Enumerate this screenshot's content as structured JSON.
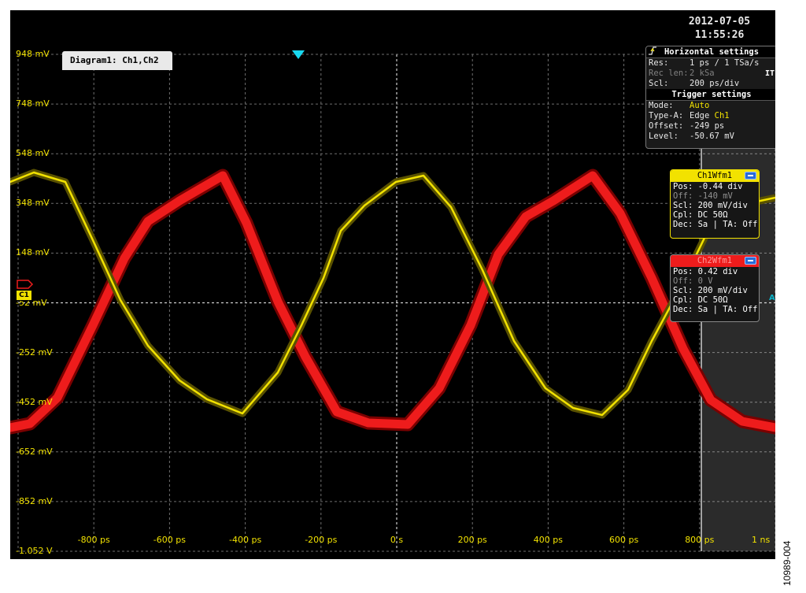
{
  "datetime": {
    "date": "2012-07-05",
    "time": "11:55:26"
  },
  "diagram": {
    "title": "Diagram1: Ch1,Ch2"
  },
  "y_axis_labels": [
    "948 mV",
    "748 mV",
    "548 mV",
    "348 mV",
    "148 mV",
    "-52 mV",
    "-252 mV",
    "-452 mV",
    "-652 mV",
    "-852 mV",
    "-1.052 V"
  ],
  "x_axis_labels": [
    "-800 ps",
    "-600 ps",
    "-400 ps",
    "-200 ps",
    "0 s",
    "200 ps",
    "400 ps",
    "600 ps",
    "800 ps",
    "1 ns"
  ],
  "horizontal_settings": {
    "header": "Horizontal settings",
    "res_key": "Res:",
    "res_val": "1 ps / 1 TSa/s",
    "reclen_key": "Rec len:",
    "reclen_val": "2 kSa",
    "scl_key": "Scl:",
    "scl_val": "200 ps/div",
    "it_label": "IT"
  },
  "trigger_settings": {
    "header": "Trigger settings",
    "mode_key": "Mode:",
    "mode_val": "Auto",
    "type_key": "Type-A:",
    "type_val": "Edge",
    "type_source": "Ch1",
    "offset_key": "Offset:",
    "offset_val": "-249 ps",
    "level_key": "Level:",
    "level_val": "-50.67 mV"
  },
  "ch1": {
    "title": "Ch1Wfm1",
    "pos": "Pos: -0.44 div",
    "off": "Off: -140 mV",
    "scl": "Scl: 200 mV/div",
    "cpl": "Cpl: DC 50Ω",
    "dec": "Dec: Sa | TA: Off",
    "marker": "C1"
  },
  "ch2": {
    "title": "Ch2Wfm1",
    "pos": "Pos: 0.42 div",
    "off": "Off: 0 V",
    "scl": "Scl: 200 mV/div",
    "cpl": "Cpl: DC 50Ω",
    "dec": "Dec: Sa | TA: Off"
  },
  "a_marker": "A",
  "figure_id": "10989-004",
  "colors": {
    "ch1": "#f2e200",
    "ch2": "#ee1c1c",
    "trigger": "#18d8f0",
    "grid": "#8c8c8c"
  }
}
